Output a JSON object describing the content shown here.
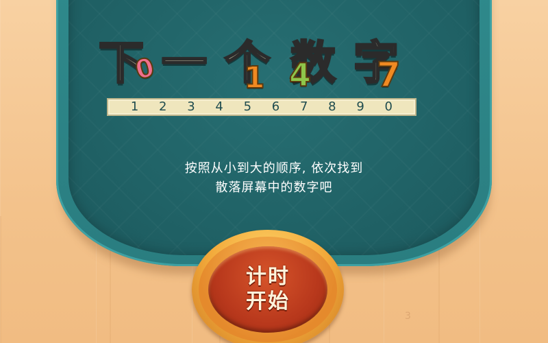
{
  "title": {
    "chars": [
      "下",
      "一",
      "个",
      "数",
      "字"
    ],
    "numbers": [
      "0",
      "1",
      "4",
      "7"
    ],
    "colors": {
      "zero": "#f06f8d",
      "one": "#f08a22",
      "four": "#8fc64a",
      "seven": "#f08a22",
      "text": "#fff7cf"
    }
  },
  "digit_strip": [
    "1",
    "2",
    "3",
    "4",
    "5",
    "6",
    "7",
    "8",
    "9",
    "0"
  ],
  "instruction": {
    "line1": "按照从小到大的顺序, 依次找到",
    "line2": "散落屏幕中的数字吧"
  },
  "start_button": {
    "line1": "计时",
    "line2": "开始"
  },
  "stray_digit": "3",
  "colors": {
    "board": "#1f6064",
    "background": "#f5c896",
    "button": "#b8381c"
  }
}
